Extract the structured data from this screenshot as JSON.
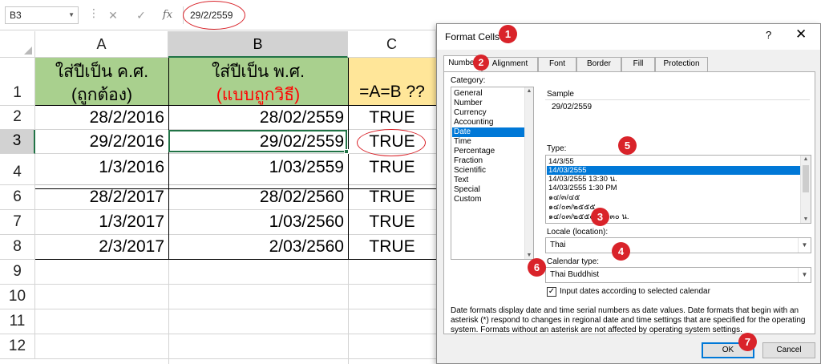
{
  "formula_bar": {
    "name_box": "B3",
    "formula": "29/2/2559",
    "fx_label": "fx"
  },
  "grid": {
    "columns": [
      "A",
      "B",
      "C"
    ],
    "row_numbers": [
      "1",
      "2",
      "3",
      "4",
      "6",
      "7",
      "8",
      "9",
      "10",
      "11",
      "12"
    ],
    "header_row": {
      "a_line1": "ใส่ปีเป็น ค.ศ.",
      "a_line2": "(ถูกต้อง)",
      "b_line1": "ใส่ปีเป็น พ.ศ.",
      "b_line2": "(แบบถูกวิธี)",
      "c": "=A=B ??"
    },
    "rows": [
      {
        "a": "28/2/2016",
        "b": "28/02/2559",
        "c": "TRUE"
      },
      {
        "a": "29/2/2016",
        "b": "29/02/2559",
        "c": "TRUE"
      },
      {
        "a": "1/3/2016",
        "b": "1/03/2559",
        "c": "TRUE"
      },
      {
        "a": "28/2/2017",
        "b": "28/02/2560",
        "c": "TRUE"
      },
      {
        "a": "1/3/2017",
        "b": "1/03/2560",
        "c": "TRUE"
      },
      {
        "a": "2/3/2017",
        "b": "2/03/2560",
        "c": "TRUE"
      }
    ]
  },
  "dialog": {
    "title": "Format Cells",
    "help": "?",
    "close": "✕",
    "tabs": [
      "Number",
      "Alignment",
      "Font",
      "Border",
      "Fill",
      "Protection"
    ],
    "category_label": "Category:",
    "categories": [
      "General",
      "Number",
      "Currency",
      "Accounting",
      "Date",
      "Time",
      "Percentage",
      "Fraction",
      "Scientific",
      "Text",
      "Special",
      "Custom"
    ],
    "selected_category": "Date",
    "sample_label": "Sample",
    "sample_value": "29/02/2559",
    "type_label": "Type:",
    "types": [
      "14/3/55",
      "14/03/2555",
      "14/03/2555 13:30 น.",
      "14/03/2555 1:30 PM",
      "๑๔/๓/๔๕",
      "๑๔/๐๓/๒๕๕๕",
      "๑๔/๐๓/๒๕๕๕ ๑๓:๓๐ น."
    ],
    "locale_label": "Locale (location):",
    "locale_value": "Thai",
    "calendar_label": "Calendar type:",
    "calendar_value": "Thai Buddhist",
    "checkbox_label": "Input dates according to selected calendar",
    "description": "Date formats display date and time serial numbers as date values.  Date formats that begin with an asterisk (*) respond to changes in regional date and time settings that are specified for the operating system. Formats without an asterisk are not affected by operating system settings.",
    "ok_label": "OK",
    "cancel_label": "Cancel"
  },
  "markers": [
    "1",
    "2",
    "3",
    "4",
    "5",
    "6",
    "7"
  ],
  "colors": {
    "header_green": "#a9d08e",
    "header_yellow": "#ffe699",
    "red_text": "#ff0000",
    "marker_red": "#d9232a",
    "excel_green": "#217346",
    "selection_blue": "#0078d7"
  }
}
